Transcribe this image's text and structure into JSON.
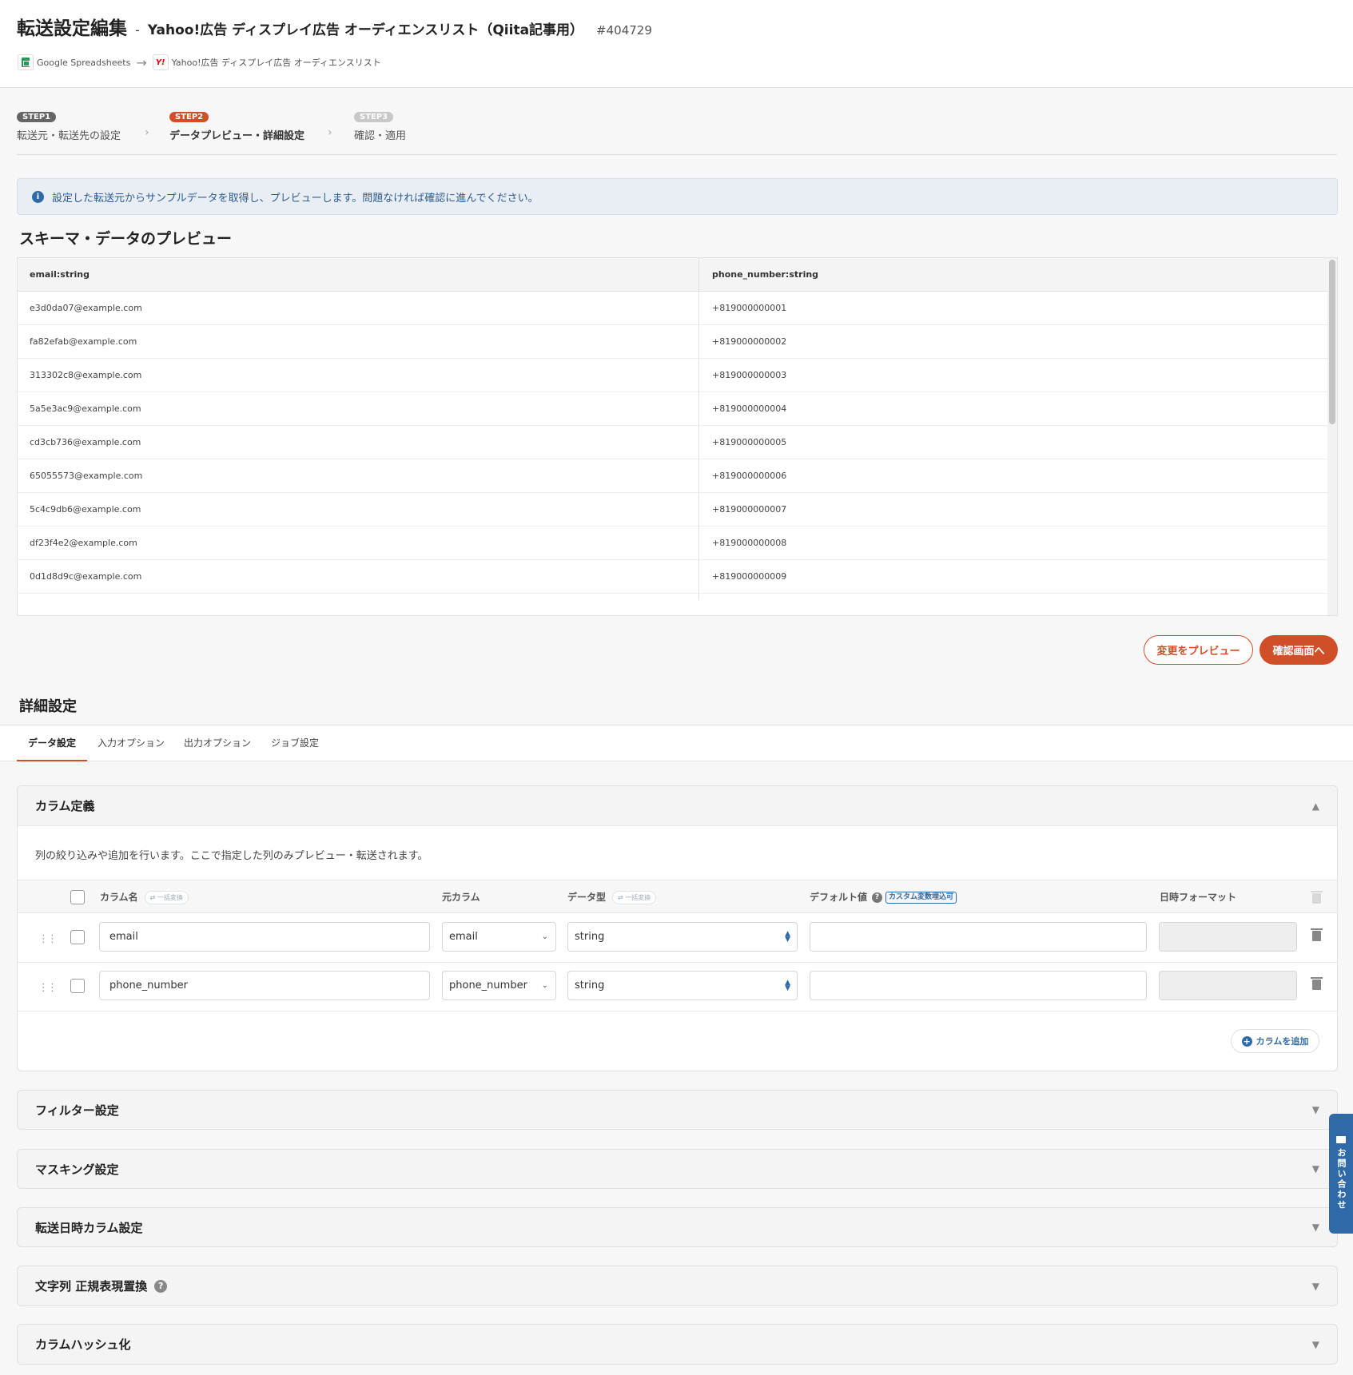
{
  "header": {
    "title": "転送設定編集",
    "separator": "-",
    "subtitle": "Yahoo!広告 ディスプレイ広告 オーディエンスリスト（Qiita記事用）",
    "id": "#404729",
    "source_name": "Google Spreadsheets",
    "dest_name": "Yahoo!広告 ディスプレイ広告 オーディエンスリスト",
    "source_icon": "google-sheets-icon",
    "dest_icon": "yahoo-icon"
  },
  "steps": [
    {
      "badge": "STEP1",
      "label": "転送元・転送先の設定"
    },
    {
      "badge": "STEP2",
      "label": "データプレビュー・詳細設定"
    },
    {
      "badge": "STEP3",
      "label": "確認・適用"
    }
  ],
  "info": {
    "icon": "info-icon",
    "text": "設定した転送元からサンプルデータを取得し、プレビューします。問題なければ確認に進んでください。"
  },
  "preview": {
    "title": "スキーマ・データのプレビュー",
    "columns": [
      "email:string",
      "phone_number:string"
    ],
    "rows": [
      [
        "e3d0da07@example.com",
        "+819000000001"
      ],
      [
        "fa82efab@example.com",
        "+819000000002"
      ],
      [
        "313302c8@example.com",
        "+819000000003"
      ],
      [
        "5a5e3ac9@example.com",
        "+819000000004"
      ],
      [
        "cd3cb736@example.com",
        "+819000000005"
      ],
      [
        "65055573@example.com",
        "+819000000006"
      ],
      [
        "5c4c9db6@example.com",
        "+819000000007"
      ],
      [
        "df23f4e2@example.com",
        "+819000000008"
      ],
      [
        "0d1d8d9c@example.com",
        "+819000000009"
      ]
    ]
  },
  "actions": {
    "preview_changes": "変更をプレビュー",
    "to_confirm": "確認画面へ"
  },
  "details": {
    "title": "詳細設定",
    "tabs": [
      "データ設定",
      "入力オプション",
      "出力オプション",
      "ジョブ設定"
    ]
  },
  "column_def": {
    "title": "カラム定義",
    "description": "列の絞り込みや追加を行います。ここで指定した列のみプレビュー・転送されます。",
    "headers": {
      "name": "カラム名",
      "bulk": "一括変換",
      "source": "元カラム",
      "type": "データ型",
      "default": "デフォルト値",
      "custom_tag": "カスタム変数埋込可",
      "datetime": "日時フォーマット"
    },
    "rows": [
      {
        "name": "email",
        "source": "email",
        "type": "string",
        "default": "",
        "datetime": ""
      },
      {
        "name": "phone_number",
        "source": "phone_number",
        "type": "string",
        "default": "",
        "datetime": ""
      }
    ],
    "add_button": "カラムを追加"
  },
  "panels": [
    "フィルター設定",
    "マスキング設定",
    "転送日時カラム設定",
    "文字列 正規表現置換",
    "カラムハッシュ化"
  ],
  "contact": "お問い合わせ",
  "colors": {
    "accent": "#d14f28",
    "info": "#2f6aa8"
  }
}
